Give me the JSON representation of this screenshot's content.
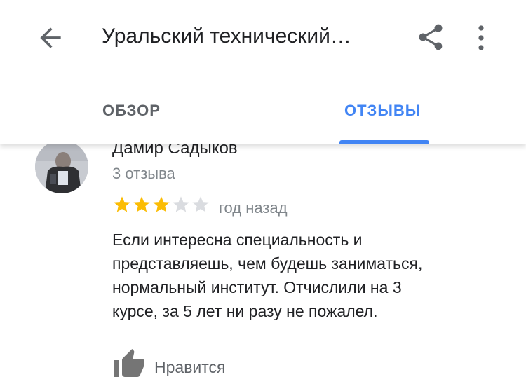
{
  "appbar": {
    "title": "Уральский технический…",
    "back_icon": "arrow-left-icon",
    "share_icon": "share-icon",
    "more_icon": "more-vert-icon"
  },
  "tabs": [
    {
      "label": "ОБЗОР",
      "active": false
    },
    {
      "label": "ОТЗЫВЫ",
      "active": true
    }
  ],
  "review": {
    "author": "Дамир Садыков",
    "reviews_count": "3 отзыва",
    "rating": 3,
    "rating_max": 5,
    "date": "год назад",
    "text_lines": [
      "Если интересна специальность и",
      "представляешь, чем будешь заниматься,",
      "нормальный институт. Отчислили на 3",
      "курсе, за 5 лет ни разу не пожалел."
    ],
    "like_label": "Нравится",
    "like_icon": "thumb-up-icon"
  },
  "colors": {
    "accent": "#4285f4",
    "star_filled": "#fbbc04",
    "star_empty": "#dadce0",
    "muted_text": "#80868b"
  }
}
